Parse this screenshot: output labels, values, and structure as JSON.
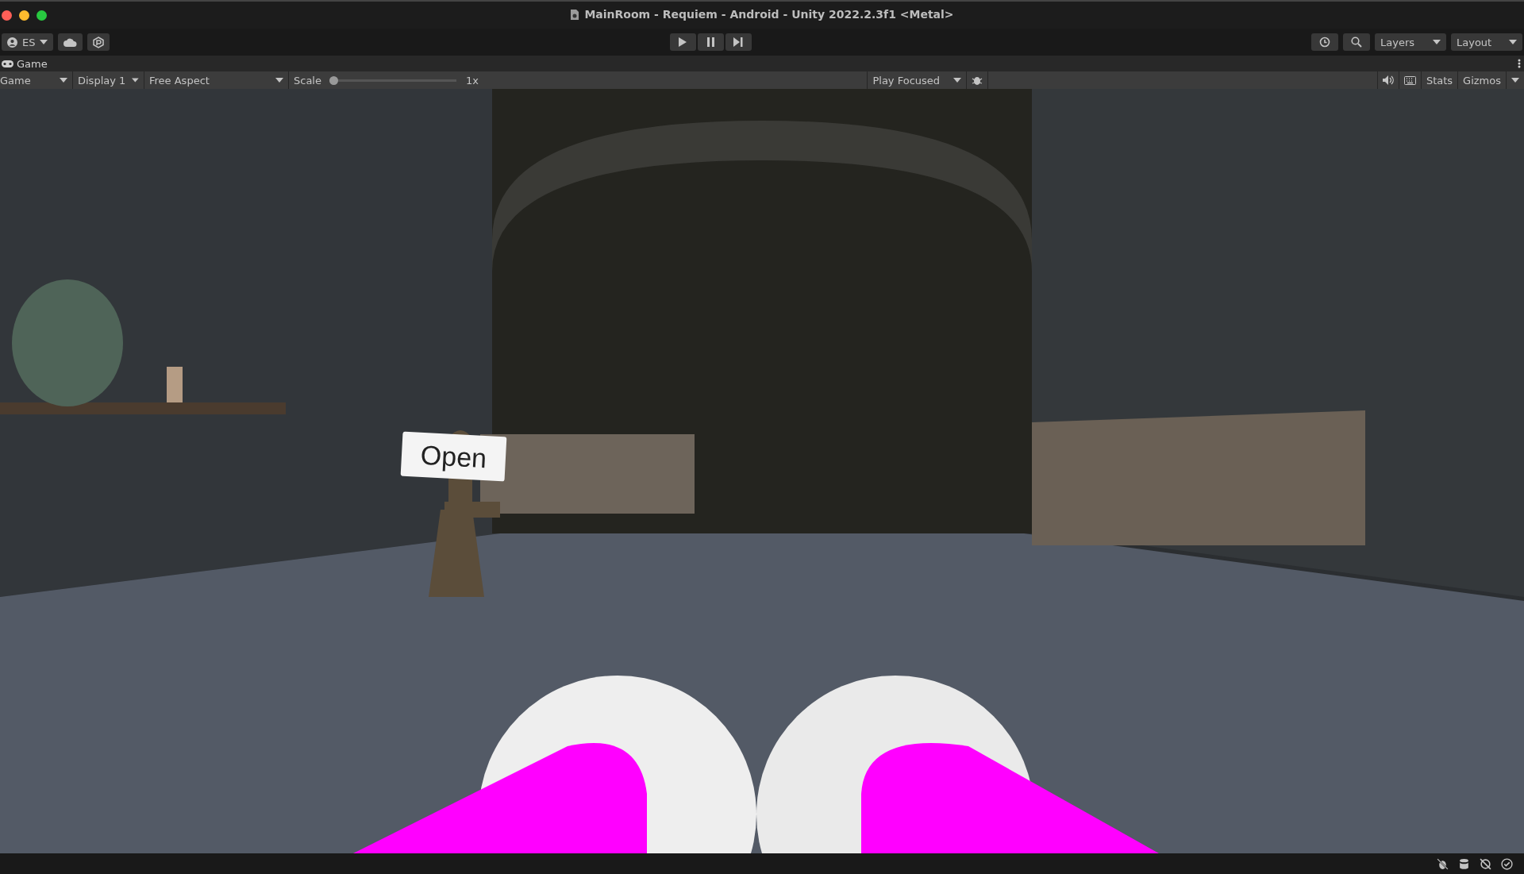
{
  "window": {
    "title": "MainRoom - Requiem - Android - Unity 2022.2.3f1 <Metal>"
  },
  "toolbar": {
    "account": "ES",
    "layers": "Layers",
    "layout": "Layout"
  },
  "tab": {
    "label": "Game"
  },
  "game_toolbar": {
    "mode": "Game",
    "display": "Display 1",
    "aspect": "Free Aspect",
    "scale_label": "Scale",
    "scale": {
      "level": 0
    },
    "scale_reading": "1x",
    "play_mode": "Play Focused",
    "stats": "Stats",
    "gizmos": "Gizmos"
  },
  "game_view": {
    "button": "Open"
  }
}
